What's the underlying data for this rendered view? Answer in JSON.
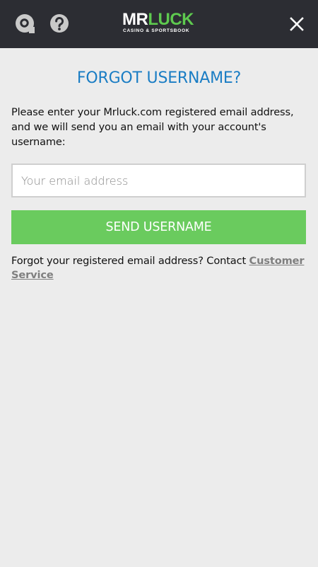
{
  "header": {
    "logo_mr": "MR",
    "logo_luck": "LUCK",
    "logo_tagline": "CASINO & SPORTSBOOK",
    "icons": [
      "support-chat-icon",
      "help-icon",
      "close-icon"
    ]
  },
  "main": {
    "title": "FORGOT USERNAME?",
    "instructions": "Please enter your Mrluck.com registered email address, and we will send you an email with your account's username:",
    "email_placeholder": "Your email address",
    "email_value": "",
    "send_button_label": "SEND USERNAME",
    "contact_text": "Forgot your registered email address? Contact ",
    "contact_link_label": "Customer Service"
  },
  "colors": {
    "header_bg": "#2c2d33",
    "page_bg": "#ececec",
    "title": "#1a7dc4",
    "button": "#6acb5e",
    "logo_accent": "#5ec94f",
    "link": "#7f7f7f"
  }
}
